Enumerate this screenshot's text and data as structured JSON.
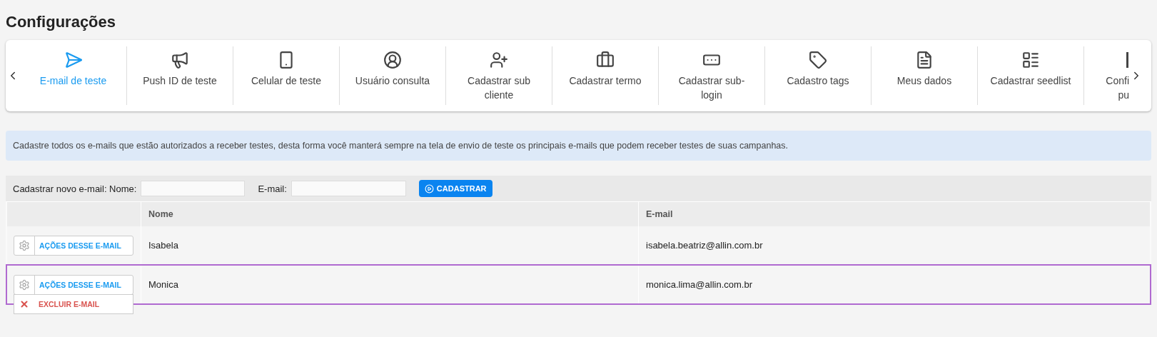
{
  "page_title": "Configurações",
  "tabs": [
    {
      "label": "E-mail de teste",
      "selected": true
    },
    {
      "label": "Push ID de teste",
      "selected": false
    },
    {
      "label": "Celular de teste",
      "selected": false
    },
    {
      "label": "Usuário consulta",
      "selected": false
    },
    {
      "label": "Cadastrar sub cliente",
      "selected": false
    },
    {
      "label": "Cadastrar termo",
      "selected": false
    },
    {
      "label": "Cadastrar sub-login",
      "selected": false
    },
    {
      "label": "Cadastro tags",
      "selected": false
    },
    {
      "label": "Meus dados",
      "selected": false
    },
    {
      "label": "Cadastrar seedlist",
      "selected": false
    },
    {
      "label": "Confi pu",
      "selected": false
    }
  ],
  "info": "Cadastre todos os e-mails que estão autorizados a receber testes, desta forma você manterá sempre na tela de envio de teste os principais e-mails que podem receber testes de suas campanhas.",
  "form": {
    "label": "Cadastrar novo e-mail: Nome:",
    "email_label": "E-mail:",
    "button": "CADASTRAR"
  },
  "table": {
    "columns": [
      "Nome",
      "E-mail"
    ],
    "rows": [
      {
        "action": "AÇÕES DESSE E-MAIL",
        "name": "Isabela",
        "email": "isabela.beatriz@allin.com.br",
        "selected": false
      },
      {
        "action": "AÇÕES DESSE E-MAIL",
        "name": "Monica",
        "email": "monica.lima@allin.com.br",
        "selected": true,
        "menu": [
          {
            "label": "EXCLUIR E-MAIL"
          }
        ]
      }
    ]
  }
}
